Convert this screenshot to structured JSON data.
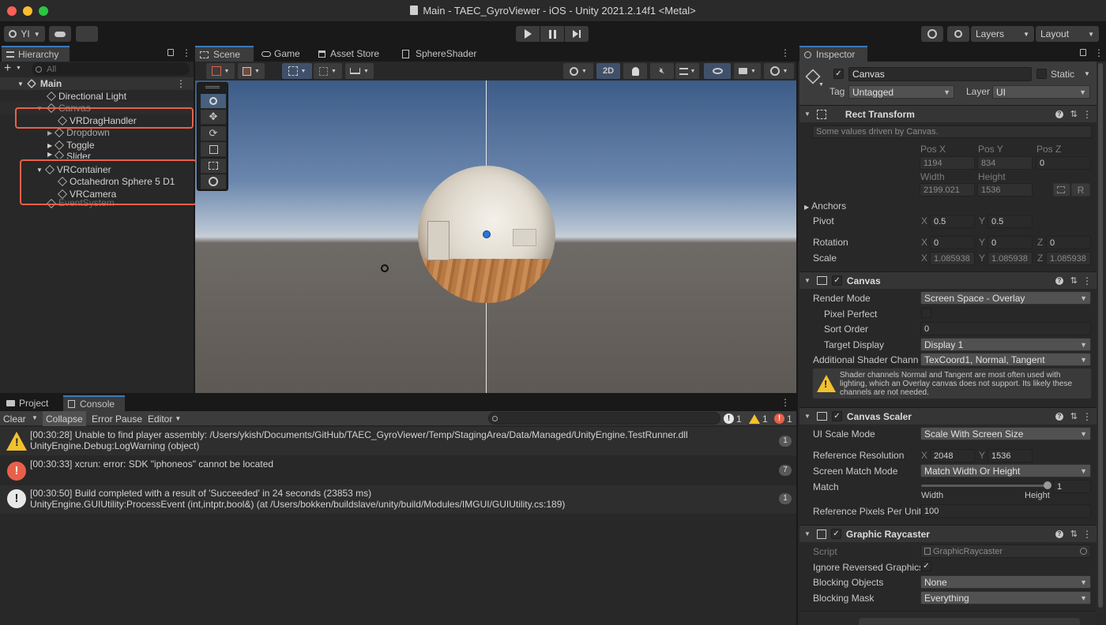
{
  "window": {
    "title": "Main - TAEC_GyroViewer - iOS - Unity 2021.2.14f1 <Metal>"
  },
  "toolbar": {
    "account": "YI",
    "layers": "Layers",
    "layout": "Layout"
  },
  "hierarchy": {
    "tab": "Hierarchy",
    "search_placeholder": "All",
    "scene": "Main",
    "items": [
      "Directional Light",
      "Canvas",
      "VRDragHandler",
      "Dropdown",
      "Toggle",
      "Slider",
      "VRContainer",
      "Octahedron Sphere 5 D1",
      "VRCamera",
      "EventSystem"
    ]
  },
  "scene": {
    "tabs": [
      "Scene",
      "Game",
      "Asset Store",
      "SphereShader"
    ],
    "mode_2d": "2D"
  },
  "console": {
    "tabs": [
      "Project",
      "Console"
    ],
    "buttons": {
      "clear": "Clear",
      "collapse": "Collapse",
      "error_pause": "Error Pause",
      "editor": "Editor"
    },
    "counts": {
      "info": "1",
      "warn": "1",
      "error": "1"
    },
    "logs": [
      {
        "line1": "[00:30:28] Unable to find player assembly: /Users/ykish/Documents/GitHub/TAEC_GyroViewer/Temp/StagingArea/Data/Managed/UnityEngine.TestRunner.dll",
        "line2": "UnityEngine.Debug:LogWarning (object)",
        "count": "1"
      },
      {
        "line1": "[00:30:33] xcrun: error: SDK \"iphoneos\" cannot be located",
        "line2": "",
        "count": "7"
      },
      {
        "line1": "[00:30:50] Build completed with a result of 'Succeeded' in 24 seconds (23853 ms)",
        "line2": "UnityEngine.GUIUtility:ProcessEvent (int,intptr,bool&) (at /Users/bokken/buildslave/unity/build/Modules/IMGUI/GUIUtility.cs:189)",
        "count": "1"
      }
    ]
  },
  "inspector": {
    "tab": "Inspector",
    "object_name": "Canvas",
    "static_label": "Static",
    "tag_label": "Tag",
    "tag_value": "Untagged",
    "layer_label": "Layer",
    "layer_value": "UI",
    "rect": {
      "title": "Rect Transform",
      "note": "Some values driven by Canvas.",
      "posx_label": "Pos X",
      "posy_label": "Pos Y",
      "posz_label": "Pos Z",
      "posx": "1194",
      "posy": "834",
      "posz": "0",
      "width_label": "Width",
      "height_label": "Height",
      "width": "2199.021",
      "height": "1536",
      "r_button": "R",
      "anchors": "Anchors",
      "pivot": "Pivot",
      "pivot_x": "0.5",
      "pivot_y": "0.5",
      "rotation": "Rotation",
      "rot_x": "0",
      "rot_y": "0",
      "rot_z": "0",
      "scale": "Scale",
      "scale_x": "1.085938",
      "scale_y": "1.085938",
      "scale_z": "1.085938",
      "x": "X",
      "y": "Y",
      "z": "Z"
    },
    "canvas": {
      "title": "Canvas",
      "render_mode_label": "Render Mode",
      "render_mode": "Screen Space - Overlay",
      "pixel_perfect": "Pixel Perfect",
      "sort_order_label": "Sort Order",
      "sort_order": "0",
      "target_display_label": "Target Display",
      "target_display": "Display 1",
      "shader_channels_label": "Additional Shader Channe",
      "shader_channels": "TexCoord1, Normal, Tangent",
      "warning_line1": "Shader channels Normal and Tangent are most often used with",
      "warning_line2": "lighting, which an Overlay canvas does not support. Its likely these",
      "warning_line3": "channels are not needed."
    },
    "scaler": {
      "title": "Canvas Scaler",
      "ui_scale_mode_label": "UI Scale Mode",
      "ui_scale_mode": "Scale With Screen Size",
      "ref_res_label": "Reference Resolution",
      "ref_x": "2048",
      "ref_y": "1536",
      "match_mode_label": "Screen Match Mode",
      "match_mode": "Match Width Or Height",
      "match_label": "Match",
      "match_value": "1",
      "match_fraction": 1,
      "width_label": "Width",
      "height_label": "Height",
      "ref_ppu_label": "Reference Pixels Per Unit",
      "ref_ppu": "100"
    },
    "raycaster": {
      "title": "Graphic Raycaster",
      "script_label": "Script",
      "script": "GraphicRaycaster",
      "ignore_label": "Ignore Reversed Graphics",
      "blocking_objects_label": "Blocking Objects",
      "blocking_objects": "None",
      "blocking_mask_label": "Blocking Mask",
      "blocking_mask": "Everything"
    }
  },
  "colors": {
    "accent": "#3a79bb",
    "highlight": "#e8604a",
    "warning": "#f2c12e",
    "error": "#e8604a"
  }
}
